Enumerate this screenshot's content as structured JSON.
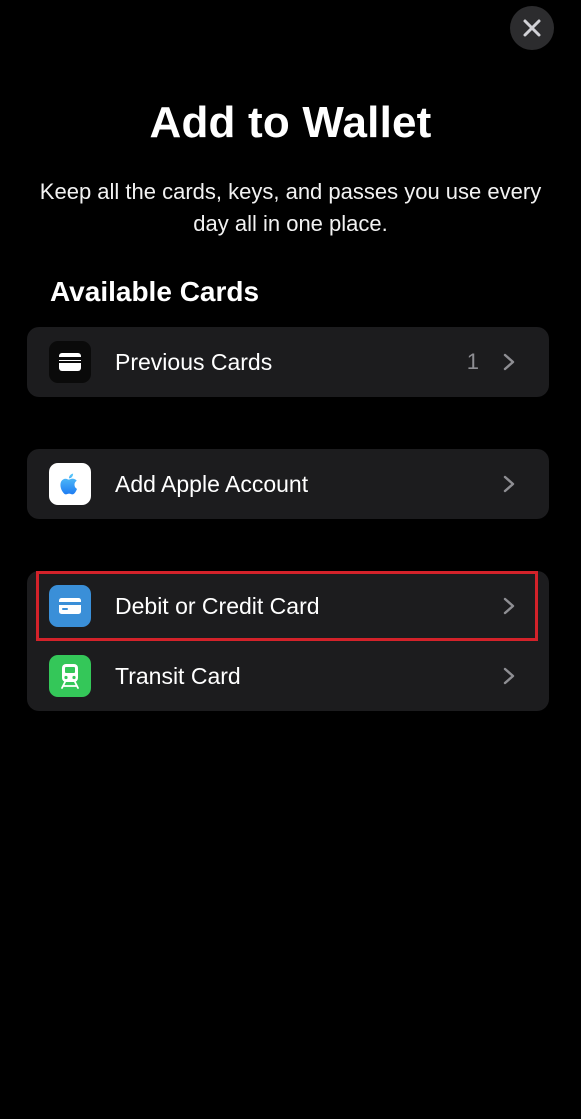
{
  "header": {
    "title": "Add to Wallet",
    "subtitle": "Keep all the cards, keys, and passes you use every day all in one place.",
    "close_icon": "close-icon"
  },
  "section": {
    "title": "Available Cards"
  },
  "groups": [
    {
      "rows": [
        {
          "label": "Previous Cards",
          "count": "1",
          "icon": "wallet-icon",
          "icon_bg": "#0a0a0a"
        }
      ]
    },
    {
      "rows": [
        {
          "label": "Add Apple Account",
          "icon": "apple-icon",
          "icon_bg": "#ffffff"
        }
      ]
    },
    {
      "rows": [
        {
          "label": "Debit or Credit Card",
          "icon": "credit-card-icon",
          "icon_bg": "#3a8fd8",
          "highlighted": true
        },
        {
          "label": "Transit Card",
          "icon": "train-icon",
          "icon_bg": "#34c759"
        }
      ]
    }
  ],
  "colors": {
    "background": "#000000",
    "row_background": "#1c1c1e",
    "chevron": "#8e8e93",
    "highlight_border": "#d3222a"
  }
}
